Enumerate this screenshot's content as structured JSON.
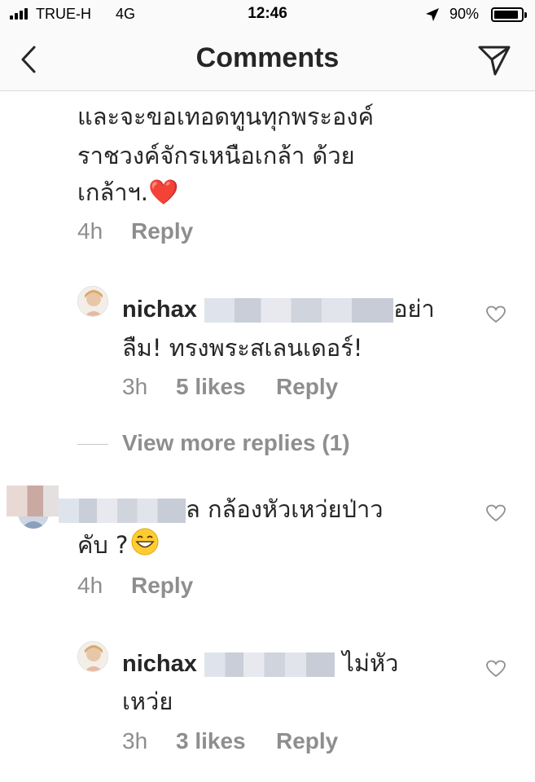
{
  "status_bar": {
    "carrier": "TRUE-H",
    "network": "4G",
    "time": "12:46",
    "battery": "90%",
    "battery_level": 0.9,
    "icons": [
      "signal-icon",
      "location-icon",
      "battery-icon"
    ]
  },
  "nav": {
    "title": "Comments",
    "back_icon": "back-chevron-icon",
    "share_icon": "direct-send-icon"
  },
  "comments": [
    {
      "text_lines": [
        "และจะขอเทอดทูนทุกพระองค์",
        "ราชวงค์จักรเหนือเกล้า ด้วย",
        "เกล้าฯ."
      ],
      "emoji": "❤️",
      "time": "4h",
      "reply": "Reply"
    },
    {
      "username": "nichax",
      "text_tail": "อย่า",
      "text_line2": "ลืม! ทรงพระสเลนเดอร์!",
      "time": "3h",
      "likes": "5 likes",
      "reply": "Reply"
    },
    {
      "view_more": "View more replies (1)"
    },
    {
      "text_tail": "ล กล้องหัวเหว่ยป่าว",
      "text_line2": "คับ ?",
      "emoji": "😁",
      "time": "4h",
      "reply": "Reply"
    },
    {
      "username": "nichax",
      "text_tail": "ไม่หัว",
      "text_line2": "เหว่ย",
      "time": "3h",
      "likes": "3 likes",
      "reply": "Reply"
    }
  ],
  "colors": {
    "text": "#262626",
    "meta": "#8e8e8e",
    "heart_red": "#e8232b"
  }
}
